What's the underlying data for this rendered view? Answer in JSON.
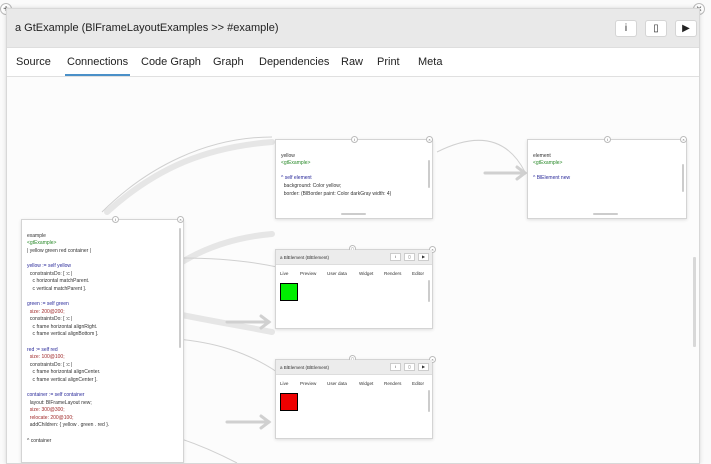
{
  "window": {
    "title": "a GtExample (BlFrameLayoutExamples >> #example)",
    "buttons": [
      "i",
      "▯",
      "▶"
    ]
  },
  "tabs": [
    "Source",
    "Connections",
    "Code Graph",
    "Graph",
    "Dependencies",
    "Raw",
    "Print",
    "Meta"
  ],
  "active_tab": "Connections",
  "cards": {
    "example": {
      "lines": [
        "example",
        "<gtExample>",
        "| yellow green red container |",
        "",
        "yellow := self yellow",
        "  constraintsDo: [ :c |",
        "    c horizontal matchParent.",
        "    c vertical matchParent ].",
        "",
        "green := self green",
        "  size: 200@200;",
        "  constraintsDo: [ :c |",
        "    c frame horizontal alignRight.",
        "    c frame vertical alignBottom ].",
        "",
        "red := self red",
        "  size: 100@100;",
        "  constraintsDo: [ :c |",
        "    c frame horizontal alignCenter.",
        "    c frame vertical alignCenter ].",
        "",
        "container := self container",
        "  layout: BlFrameLayout new;",
        "  size: 300@300;",
        "  relocate: 200@100;",
        "  addChildren: { yellow . green . red }.",
        "",
        "^ container"
      ]
    },
    "yellow": {
      "lines": [
        "yellow",
        "<gtExample>",
        "",
        "^ self element",
        "  background: Color yellow;",
        "  border: (BlBorder paint: Color darkGray width: 4)"
      ]
    },
    "element": {
      "lines": [
        "element",
        "<gtExample>",
        "",
        "^ BlElement new"
      ]
    },
    "green_view": {
      "title": "a BlElement (BlElement)",
      "subtabs": [
        "Live",
        "Preview",
        "User data",
        "Widget",
        "Renders",
        "Editor"
      ],
      "color": "#00ee00"
    },
    "red_view": {
      "title": "a BlElement (BlElement)",
      "subtabs": [
        "Live",
        "Preview",
        "User data",
        "Widget",
        "Renders",
        "Editor"
      ],
      "color": "#ee0000"
    }
  },
  "corner_icons": {
    "add": "+",
    "close": "×"
  }
}
